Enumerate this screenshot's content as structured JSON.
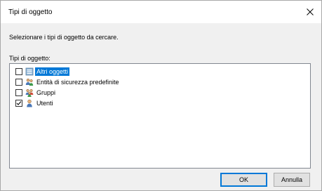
{
  "window": {
    "title": "Tipi di oggetto"
  },
  "instruction": "Selezionare i tipi di oggetto da cercare.",
  "list": {
    "label": "Tipi di oggetto:",
    "items": [
      {
        "label": "Altri oggetti",
        "checked": false,
        "selected": true,
        "icon": "folder-objects-icon"
      },
      {
        "label": "Entità di sicurezza predefinite",
        "checked": false,
        "selected": false,
        "icon": "security-principals-icon"
      },
      {
        "label": "Gruppi",
        "checked": false,
        "selected": false,
        "icon": "group-icon"
      },
      {
        "label": "Utenti",
        "checked": true,
        "selected": false,
        "icon": "user-icon"
      }
    ]
  },
  "buttons": {
    "ok": "OK",
    "cancel": "Annulla"
  },
  "colors": {
    "selection": "#0078d7",
    "dialog_bg": "#f0f0f0"
  }
}
